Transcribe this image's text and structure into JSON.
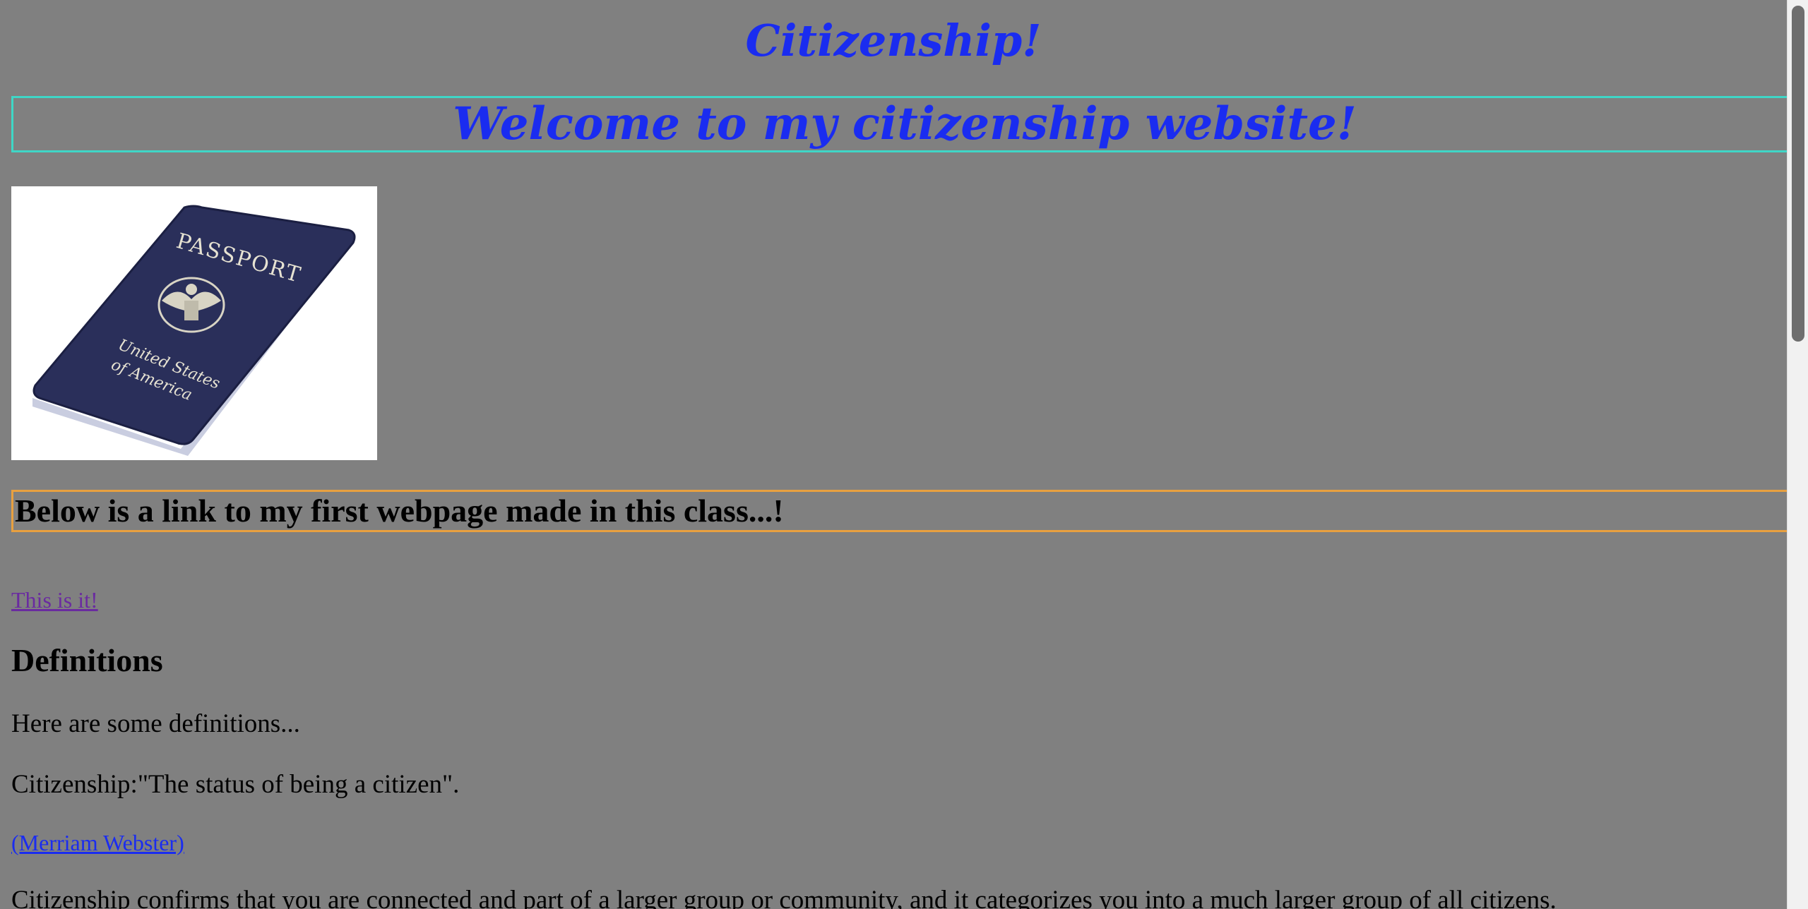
{
  "page": {
    "title": "Citizenship!",
    "welcome": "Welcome to my citizenship website!",
    "image": {
      "passport_label": "PASSPORT",
      "country_line1": "United States",
      "country_line2": "of America"
    },
    "link_heading": "Below is a link to my first webpage made in this class...!",
    "first_link": "This is it! ",
    "definitions_heading": "Definitions",
    "intro": "Here are some definitions...",
    "citizenship_def": "Citizenship:\"The status of being a citizen\".",
    "source_link": "(Merriam Webster)",
    "paragraph": "Citizenship confirms that you are connected and part of a larger group or community, and it categorizes you into a much larger group of all citizens."
  },
  "colors": {
    "background": "#808080",
    "title": "#1a2cf0",
    "welcome_border": "#3fd6c6",
    "heading_border": "#e8a040",
    "visited_link": "#6a2ba0",
    "link": "#1a2cf0"
  }
}
